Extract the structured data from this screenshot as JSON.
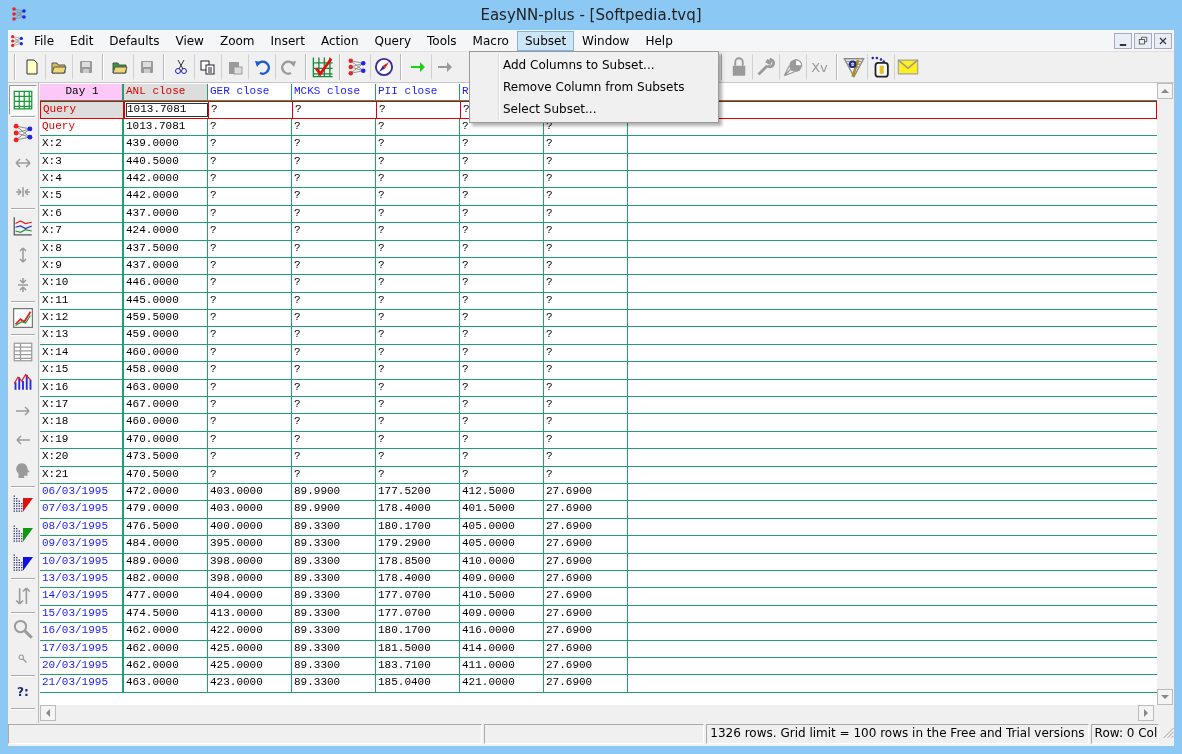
{
  "window": {
    "title": "EasyNN-plus - [Softpedia.tvq]"
  },
  "menu_bar": [
    {
      "label": "File",
      "selected": false
    },
    {
      "label": "Edit",
      "selected": false
    },
    {
      "label": "Defaults",
      "selected": false
    },
    {
      "label": "View",
      "selected": false
    },
    {
      "label": "Zoom",
      "selected": false
    },
    {
      "label": "Insert",
      "selected": false
    },
    {
      "label": "Action",
      "selected": false
    },
    {
      "label": "Query",
      "selected": false
    },
    {
      "label": "Tools",
      "selected": false
    },
    {
      "label": "Macro",
      "selected": false
    },
    {
      "label": "Subset",
      "selected": true
    },
    {
      "label": "Window",
      "selected": false
    },
    {
      "label": "Help",
      "selected": false
    }
  ],
  "subset_menu": [
    "Add Columns to Subset...",
    "Remove Column from Subsets",
    "Select Subset..."
  ],
  "toolbar_groups": [
    [
      {
        "disabled": false
      },
      {
        "disabled": false
      },
      {
        "disabled": true
      }
    ],
    [
      {
        "disabled": false
      },
      {
        "disabled": true
      }
    ],
    [
      {
        "disabled": false
      },
      {
        "disabled": false
      },
      {
        "disabled": true
      },
      {
        "disabled": false
      },
      {
        "disabled": true
      }
    ],
    [
      {
        "disabled": false
      }
    ],
    [
      {
        "disabled": false
      },
      {
        "disabled": false
      }
    ],
    [
      {
        "disabled": false
      },
      {
        "disabled": true
      }
    ],
    [
      {
        "disabled": true
      },
      {
        "disabled": true
      },
      {
        "disabled": true
      },
      {
        "disabled": true,
        "label": "Xv"
      }
    ],
    [
      {
        "disabled": false
      },
      {
        "disabled": false
      },
      {
        "disabled": false
      }
    ]
  ],
  "side_toolbar": [
    {
      "disabled": false,
      "selected": true
    },
    {
      "disabled": false,
      "selected": false
    },
    {
      "disabled": true,
      "selected": false
    },
    {
      "disabled": true,
      "selected": false
    },
    {
      "disabled": false,
      "selected": false
    },
    {
      "disabled": true,
      "selected": false
    },
    {
      "disabled": true,
      "selected": false
    },
    {
      "disabled": false,
      "selected": false
    },
    {
      "disabled": true,
      "selected": false
    },
    {
      "disabled": false,
      "selected": false
    },
    {
      "disabled": true,
      "selected": false
    },
    {
      "disabled": true,
      "selected": false
    },
    {
      "disabled": true,
      "selected": false
    },
    {
      "disabled": false,
      "selected": false
    },
    {
      "disabled": false,
      "selected": false
    },
    {
      "disabled": false,
      "selected": false
    },
    {
      "disabled": true,
      "selected": false
    },
    {
      "disabled": true,
      "selected": false
    },
    {
      "disabled": true,
      "selected": false
    },
    {
      "disabled": false,
      "selected": false,
      "label": "?:"
    }
  ],
  "grid": {
    "columns": [
      {
        "label": "Day 1",
        "kind": "corner",
        "selected": false
      },
      {
        "label": "ANL close",
        "kind": "input",
        "selected": true
      },
      {
        "label": "GER close",
        "kind": "input",
        "selected": false
      },
      {
        "label": "MCKS close",
        "kind": "input",
        "selected": false
      },
      {
        "label": "PII close",
        "kind": "input",
        "selected": false
      },
      {
        "label": "R",
        "kind": "input",
        "selected": false
      }
    ],
    "rows": [
      {
        "label": "Query",
        "kind": "query",
        "selected": true,
        "values": [
          "1013.7081",
          "?",
          "?",
          "?",
          "?"
        ]
      },
      {
        "label": "Query",
        "kind": "query",
        "selected": false,
        "values": [
          "1013.7081",
          "?",
          "?",
          "?",
          "?",
          "?"
        ]
      },
      {
        "label": "X:2",
        "kind": "example",
        "selected": false,
        "values": [
          "439.0000",
          "?",
          "?",
          "?",
          "?",
          "?"
        ]
      },
      {
        "label": "X:3",
        "kind": "example",
        "selected": false,
        "values": [
          "440.5000",
          "?",
          "?",
          "?",
          "?",
          "?"
        ]
      },
      {
        "label": "X:4",
        "kind": "example",
        "selected": false,
        "values": [
          "442.0000",
          "?",
          "?",
          "?",
          "?",
          "?"
        ]
      },
      {
        "label": "X:5",
        "kind": "example",
        "selected": false,
        "values": [
          "442.0000",
          "?",
          "?",
          "?",
          "?",
          "?"
        ]
      },
      {
        "label": "X:6",
        "kind": "example",
        "selected": false,
        "values": [
          "437.0000",
          "?",
          "?",
          "?",
          "?",
          "?"
        ]
      },
      {
        "label": "X:7",
        "kind": "example",
        "selected": false,
        "values": [
          "424.0000",
          "?",
          "?",
          "?",
          "?",
          "?"
        ]
      },
      {
        "label": "X:8",
        "kind": "example",
        "selected": false,
        "values": [
          "437.5000",
          "?",
          "?",
          "?",
          "?",
          "?"
        ]
      },
      {
        "label": "X:9",
        "kind": "example",
        "selected": false,
        "values": [
          "437.0000",
          "?",
          "?",
          "?",
          "?",
          "?"
        ]
      },
      {
        "label": "X:10",
        "kind": "example",
        "selected": false,
        "values": [
          "446.0000",
          "?",
          "?",
          "?",
          "?",
          "?"
        ]
      },
      {
        "label": "X:11",
        "kind": "example",
        "selected": false,
        "values": [
          "445.0000",
          "?",
          "?",
          "?",
          "?",
          "?"
        ]
      },
      {
        "label": "X:12",
        "kind": "example",
        "selected": false,
        "values": [
          "459.5000",
          "?",
          "?",
          "?",
          "?",
          "?"
        ]
      },
      {
        "label": "X:13",
        "kind": "example",
        "selected": false,
        "values": [
          "459.0000",
          "?",
          "?",
          "?",
          "?",
          "?"
        ]
      },
      {
        "label": "X:14",
        "kind": "example",
        "selected": false,
        "values": [
          "460.0000",
          "?",
          "?",
          "?",
          "?",
          "?"
        ]
      },
      {
        "label": "X:15",
        "kind": "example",
        "selected": false,
        "values": [
          "458.0000",
          "?",
          "?",
          "?",
          "?",
          "?"
        ]
      },
      {
        "label": "X:16",
        "kind": "example",
        "selected": false,
        "values": [
          "463.0000",
          "?",
          "?",
          "?",
          "?",
          "?"
        ]
      },
      {
        "label": "X:17",
        "kind": "example",
        "selected": false,
        "values": [
          "467.0000",
          "?",
          "?",
          "?",
          "?",
          "?"
        ]
      },
      {
        "label": "X:18",
        "kind": "example",
        "selected": false,
        "values": [
          "460.0000",
          "?",
          "?",
          "?",
          "?",
          "?"
        ]
      },
      {
        "label": "X:19",
        "kind": "example",
        "selected": false,
        "values": [
          "470.0000",
          "?",
          "?",
          "?",
          "?",
          "?"
        ]
      },
      {
        "label": "X:20",
        "kind": "example",
        "selected": false,
        "values": [
          "473.5000",
          "?",
          "?",
          "?",
          "?",
          "?"
        ]
      },
      {
        "label": "X:21",
        "kind": "example",
        "selected": false,
        "values": [
          "470.5000",
          "?",
          "?",
          "?",
          "?",
          "?"
        ]
      },
      {
        "label": "06/03/1995",
        "kind": "date",
        "selected": false,
        "values": [
          "472.0000",
          "403.0000",
          "89.9900",
          "177.5200",
          "412.5000",
          "27.6900"
        ]
      },
      {
        "label": "07/03/1995",
        "kind": "date",
        "selected": false,
        "values": [
          "479.0000",
          "403.0000",
          "89.9900",
          "178.4000",
          "401.5000",
          "27.6900"
        ]
      },
      {
        "label": "08/03/1995",
        "kind": "date",
        "selected": false,
        "values": [
          "476.5000",
          "400.0000",
          "89.3300",
          "180.1700",
          "405.0000",
          "27.6900"
        ]
      },
      {
        "label": "09/03/1995",
        "kind": "date",
        "selected": false,
        "values": [
          "484.0000",
          "395.0000",
          "89.3300",
          "179.2900",
          "405.0000",
          "27.6900"
        ]
      },
      {
        "label": "10/03/1995",
        "kind": "date",
        "selected": false,
        "values": [
          "489.0000",
          "398.0000",
          "89.3300",
          "178.8500",
          "410.0000",
          "27.6900"
        ]
      },
      {
        "label": "13/03/1995",
        "kind": "date",
        "selected": false,
        "values": [
          "482.0000",
          "398.0000",
          "89.3300",
          "178.4000",
          "409.0000",
          "27.6900"
        ]
      },
      {
        "label": "14/03/1995",
        "kind": "date",
        "selected": false,
        "values": [
          "477.0000",
          "404.0000",
          "89.3300",
          "177.0700",
          "410.5000",
          "27.6900"
        ]
      },
      {
        "label": "15/03/1995",
        "kind": "date",
        "selected": false,
        "values": [
          "474.5000",
          "413.0000",
          "89.3300",
          "177.0700",
          "409.0000",
          "27.6900"
        ]
      },
      {
        "label": "16/03/1995",
        "kind": "date",
        "selected": false,
        "values": [
          "462.0000",
          "422.0000",
          "89.3300",
          "180.1700",
          "416.0000",
          "27.6900"
        ]
      },
      {
        "label": "17/03/1995",
        "kind": "date",
        "selected": false,
        "values": [
          "462.0000",
          "425.0000",
          "89.3300",
          "181.5000",
          "414.0000",
          "27.6900"
        ]
      },
      {
        "label": "20/03/1995",
        "kind": "date",
        "selected": false,
        "values": [
          "462.0000",
          "425.0000",
          "89.3300",
          "183.7100",
          "411.0000",
          "27.6900"
        ]
      },
      {
        "label": "21/03/1995",
        "kind": "date",
        "selected": false,
        "values": [
          "463.0000",
          "423.0000",
          "89.3300",
          "185.0400",
          "421.0000",
          "27.6900"
        ]
      }
    ]
  },
  "status_bar": {
    "message": "1326 rows. Grid limit = 100 rows in the Free and Trial versions",
    "position": "Row: 0  Col"
  }
}
